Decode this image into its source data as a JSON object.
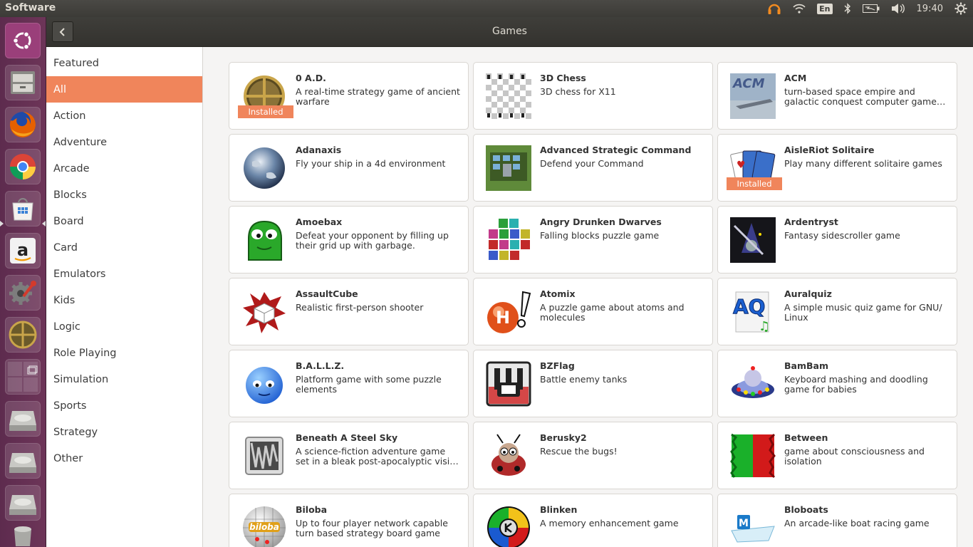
{
  "panel": {
    "app_title": "Software",
    "keyboard_layout": "En",
    "clock": "19:40",
    "indicator_icons": [
      "headphones-icon",
      "wifi-icon",
      "keyboard-layout-indicator",
      "bluetooth-icon",
      "battery-icon",
      "volume-icon",
      "gear-icon"
    ]
  },
  "launcher": {
    "items": [
      {
        "name": "ubuntu-dash-icon"
      },
      {
        "name": "file-manager-icon"
      },
      {
        "name": "firefox-icon"
      },
      {
        "name": "chrome-icon"
      },
      {
        "name": "software-center-icon"
      },
      {
        "name": "amazon-icon"
      },
      {
        "name": "system-settings-icon"
      },
      {
        "name": "zero-ad-icon"
      },
      {
        "name": "workspace-switcher-icon"
      },
      {
        "name": "drive-icon"
      },
      {
        "name": "drive-icon"
      },
      {
        "name": "drive-icon"
      },
      {
        "name": "trash-icon"
      }
    ]
  },
  "header": {
    "title": "Games",
    "back_icon": "chevron-left-icon"
  },
  "sidebar": {
    "items": [
      {
        "label": "Featured",
        "active": false
      },
      {
        "label": "All",
        "active": true
      },
      {
        "label": "Action",
        "active": false
      },
      {
        "label": "Adventure",
        "active": false
      },
      {
        "label": "Arcade",
        "active": false
      },
      {
        "label": "Blocks",
        "active": false
      },
      {
        "label": "Board",
        "active": false
      },
      {
        "label": "Card",
        "active": false
      },
      {
        "label": "Emulators",
        "active": false
      },
      {
        "label": "Kids",
        "active": false
      },
      {
        "label": "Logic",
        "active": false
      },
      {
        "label": "Role Playing",
        "active": false
      },
      {
        "label": "Simulation",
        "active": false
      },
      {
        "label": "Sports",
        "active": false
      },
      {
        "label": "Strategy",
        "active": false
      },
      {
        "label": "Other",
        "active": false
      }
    ]
  },
  "apps": [
    {
      "name": "0 A.D.",
      "desc": "A real-time strategy game of ancient warfare",
      "badge": "Installed",
      "icon": "zero-ad-icon"
    },
    {
      "name": "3D Chess",
      "desc": "3D chess for X11",
      "badge": "",
      "icon": "chess-icon"
    },
    {
      "name": "ACM",
      "desc": "turn-based space empire and galactic conquest computer game (client)",
      "badge": "",
      "icon": "acm-icon"
    },
    {
      "name": "Adanaxis",
      "desc": "Fly your ship in a 4d environment",
      "badge": "",
      "icon": "planet-icon"
    },
    {
      "name": "Advanced Strategic Command",
      "desc": "Defend your Command",
      "badge": "",
      "icon": "asc-icon"
    },
    {
      "name": "AisleRiot Solitaire",
      "desc": "Play many different solitaire games",
      "badge": "Installed",
      "icon": "cards-icon"
    },
    {
      "name": "Amoebax",
      "desc": "Defeat your opponent by filling up their grid up with garbage.",
      "badge": "",
      "icon": "amoeba-icon"
    },
    {
      "name": "Angry Drunken Dwarves",
      "desc": "Falling blocks puzzle game",
      "badge": "",
      "icon": "blocks-icon"
    },
    {
      "name": "Ardentryst",
      "desc": "Fantasy sidescroller game",
      "badge": "",
      "icon": "wizard-icon"
    },
    {
      "name": "AssaultCube",
      "desc": "Realistic first-person shooter",
      "badge": "",
      "icon": "splat-cube-icon"
    },
    {
      "name": "Atomix",
      "desc": "A puzzle game about atoms and molecules",
      "badge": "",
      "icon": "atom-icon"
    },
    {
      "name": "Auralquiz",
      "desc": "A simple music quiz game for GNU/ Linux",
      "badge": "",
      "icon": "aq-icon"
    },
    {
      "name": "B.A.L.L.Z.",
      "desc": "Platform game with some puzzle elements",
      "badge": "",
      "icon": "blue-ball-icon"
    },
    {
      "name": "BZFlag",
      "desc": "Battle enemy tanks",
      "badge": "",
      "icon": "tank-icon"
    },
    {
      "name": "BamBam",
      "desc": "Keyboard mashing and doodling game for babies",
      "badge": "",
      "icon": "ufo-icon"
    },
    {
      "name": "Beneath A Steel Sky",
      "desc": "A science-fiction adventure game set in a bleak post-apocalyptic vision of…",
      "badge": "",
      "icon": "steel-sky-icon"
    },
    {
      "name": "Berusky2",
      "desc": "Rescue the bugs!",
      "badge": "",
      "icon": "bug-icon"
    },
    {
      "name": "Between",
      "desc": "game about consciousness and isolation",
      "badge": "",
      "icon": "between-icon"
    },
    {
      "name": "Biloba",
      "desc": "Up to four player network capable turn based strategy board game",
      "badge": "",
      "icon": "biloba-icon"
    },
    {
      "name": "Blinken",
      "desc": "A memory enhancement game",
      "badge": "",
      "icon": "blinken-icon"
    },
    {
      "name": "Bloboats",
      "desc": "An arcade-like boat racing game",
      "badge": "",
      "icon": "boat-icon"
    }
  ]
}
